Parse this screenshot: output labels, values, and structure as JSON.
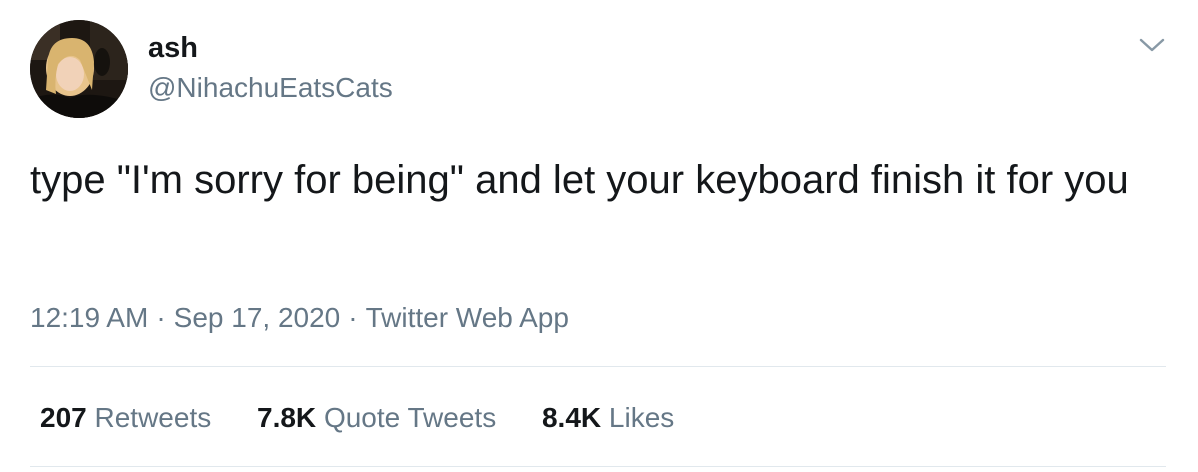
{
  "user": {
    "display_name": "ash",
    "handle": "@NihachuEatsCats"
  },
  "tweet": {
    "text": "type \"I'm sorry for being\" and let your keyboard finish it for you"
  },
  "meta": {
    "time": "12:19 AM",
    "separator": "·",
    "date": "Sep 17, 2020",
    "source": "Twitter Web App"
  },
  "stats": {
    "retweets_count": "207",
    "retweets_label": "Retweets",
    "quote_tweets_count": "7.8K",
    "quote_tweets_label": "Quote Tweets",
    "likes_count": "8.4K",
    "likes_label": "Likes"
  },
  "icons": {
    "more": "chevron-down-icon"
  },
  "colors": {
    "text_primary": "#14171a",
    "text_secondary": "#657786",
    "divider": "#e1e8ed"
  }
}
